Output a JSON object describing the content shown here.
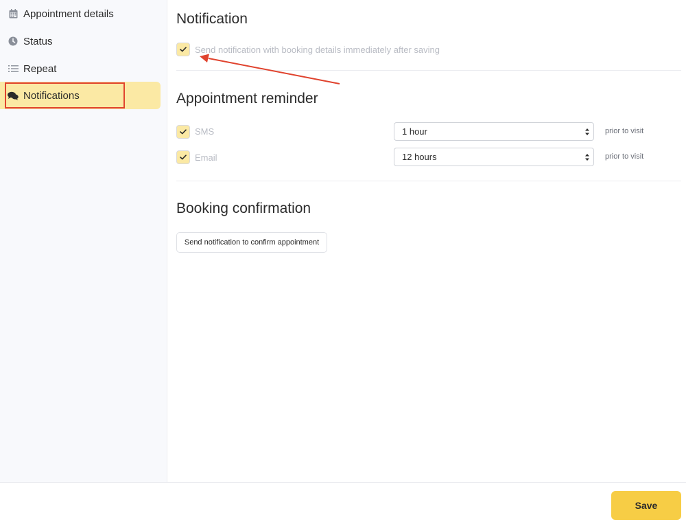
{
  "sidebar": {
    "items": [
      {
        "label": "Appointment details",
        "icon": "calendar-icon"
      },
      {
        "label": "Status",
        "icon": "clock-icon"
      },
      {
        "label": "Repeat",
        "icon": "list-icon"
      },
      {
        "label": "Notifications",
        "icon": "chat-bubbles-icon",
        "active": true
      }
    ]
  },
  "notification": {
    "title": "Notification",
    "send_label": "Send notification with booking details immediately after saving",
    "send_checked": true
  },
  "reminder": {
    "title": "Appointment reminder",
    "rows": [
      {
        "channel": "SMS",
        "checked": true,
        "value": "1 hour",
        "suffix": "prior to visit"
      },
      {
        "channel": "Email",
        "checked": true,
        "value": "12 hours",
        "suffix": "prior to visit"
      }
    ]
  },
  "confirmation": {
    "title": "Booking confirmation",
    "button_label": "Send notification to confirm appointment"
  },
  "footer": {
    "save_label": "Save"
  },
  "colors": {
    "accent": "#f7cd45",
    "active_bg": "#fbe9a4",
    "annotation": "#e0432e"
  }
}
